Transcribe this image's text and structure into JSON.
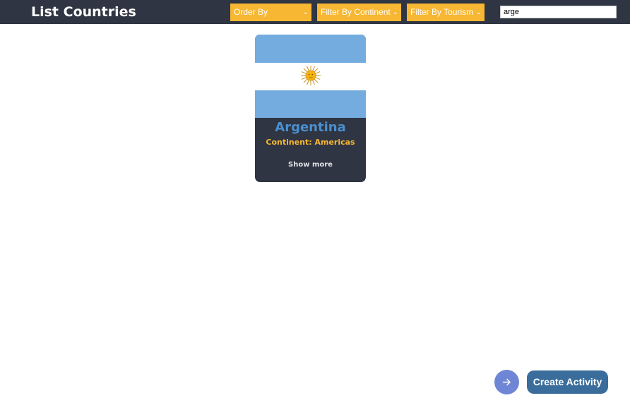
{
  "header": {
    "title": "List Countries",
    "order_by": "Order By",
    "filter_continent": "Filter By Continent",
    "filter_tourism": "Filter By Tourism",
    "search_value": "arge"
  },
  "icons": {
    "select_chevron": "chevron-down-icon",
    "flag_emblem": "sun-of-may-icon",
    "next": "arrow-right-icon"
  },
  "cards": [
    {
      "name": "Argentina",
      "continent_label": "Continent: Americas",
      "show_more": "Show more"
    }
  ],
  "footer": {
    "create_activity": "Create Activity"
  },
  "colors": {
    "header_bg": "#2f3542",
    "accent_yellow": "#f7b733",
    "country_name": "#4a8fd0",
    "flag_blue": "#74acdf",
    "next_button": "#6f86d6",
    "create_button": "#3a6d9b"
  }
}
